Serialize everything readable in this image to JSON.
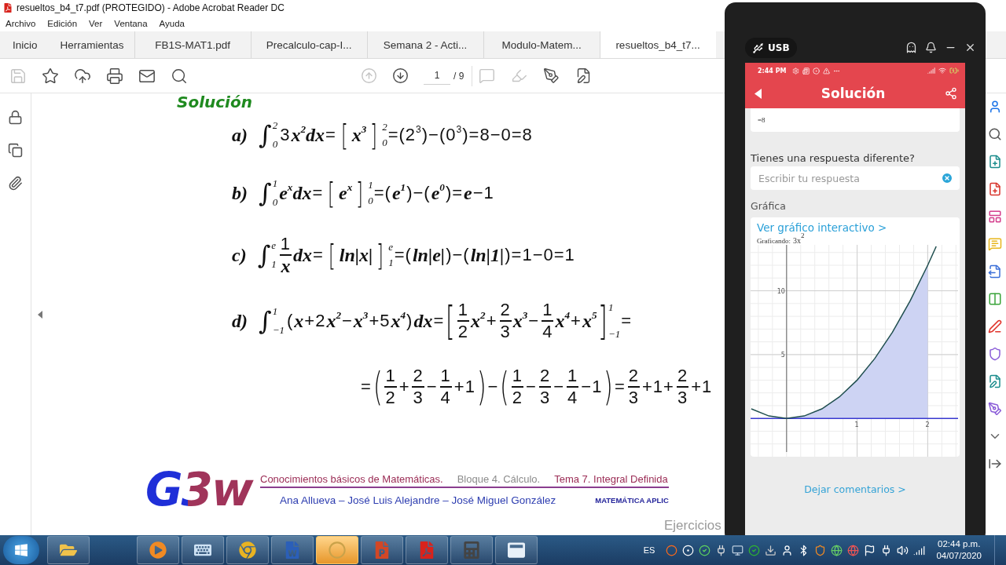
{
  "window": {
    "title": "resueltos_b4_t7.pdf (PROTEGIDO) - Adobe Acrobat Reader DC"
  },
  "menu": [
    "Archivo",
    "Edición",
    "Ver",
    "Ventana",
    "Ayuda"
  ],
  "tabs": [
    {
      "label": "Inicio",
      "kind": "nav",
      "selected": false
    },
    {
      "label": "Herramientas",
      "kind": "nav",
      "selected": false
    },
    {
      "label": "FB1S-MAT1.pdf",
      "kind": "doc",
      "selected": false
    },
    {
      "label": "Precalculo-cap-I...",
      "kind": "doc",
      "selected": false
    },
    {
      "label": "Semana 2 - Acti...",
      "kind": "doc",
      "selected": false
    },
    {
      "label": "Modulo-Matem...",
      "kind": "doc",
      "selected": false
    },
    {
      "label": "resueltos_b4_t7...",
      "kind": "doc",
      "selected": true
    }
  ],
  "toolbar": {
    "tools": [
      {
        "disabled": true
      },
      {
        "disabled": false
      },
      {
        "disabled": false
      },
      {
        "disabled": false
      },
      {
        "disabled": false
      },
      {
        "disabled": false
      }
    ],
    "nav": [
      {
        "disabled": true
      },
      {
        "disabled": false
      }
    ],
    "page_number": "1",
    "page_count": "/ 9",
    "edit_tools": [
      {
        "disabled": true
      },
      {
        "disabled": true
      },
      {
        "disabled": false
      },
      {
        "disabled": false
      }
    ]
  },
  "document": {
    "heading": "Solución",
    "equations": [
      {
        "kind": "line",
        "tokens": [
          {
            "kind": "var",
            "text": "a)"
          },
          {
            "kind": "int",
            "sign": "∫",
            "lower": "0",
            "upper": "2"
          },
          {
            "kind": "num",
            "text": "3"
          },
          {
            "kind": "var",
            "text": "x$^{2}$dx"
          },
          {
            "kind": "num",
            "text": "="
          },
          {
            "kind": "group",
            "open": "[",
            "close": "]",
            "lower": "0",
            "upper": "2",
            "body": [
              {
                "kind": "var",
                "text": "x$^{3}$"
              }
            ]
          },
          {
            "kind": "num",
            "text": "=(2$^{3}$)−(0$^{3}$)=8−0=8"
          }
        ]
      },
      {
        "kind": "line",
        "tokens": [
          {
            "kind": "var",
            "text": "b)"
          },
          {
            "kind": "int",
            "sign": "∫",
            "lower": "0",
            "upper": "1"
          },
          {
            "kind": "var",
            "text": "e$^{x}$dx"
          },
          {
            "kind": "num",
            "text": "="
          },
          {
            "kind": "group",
            "open": "[",
            "close": "]",
            "lower": "0",
            "upper": "1",
            "body": [
              {
                "kind": "var",
                "text": "e$^{x}$"
              }
            ]
          },
          {
            "kind": "num",
            "text": "=("
          },
          {
            "kind": "var",
            "text": "e$^{1}$"
          },
          {
            "kind": "num",
            "text": ")−("
          },
          {
            "kind": "var",
            "text": "e$^{0}$"
          },
          {
            "kind": "num",
            "text": ")="
          },
          {
            "kind": "var",
            "text": "e"
          },
          {
            "kind": "num",
            "text": "−1"
          }
        ]
      },
      {
        "kind": "line",
        "tokens": [
          {
            "kind": "var",
            "text": "c)"
          },
          {
            "kind": "int",
            "sign": "∫",
            "lower": "1",
            "upper": "e"
          },
          {
            "kind": "frac",
            "num": [
              {
                "kind": "num",
                "text": "1"
              }
            ],
            "den": [
              {
                "kind": "var",
                "text": "x"
              }
            ]
          },
          {
            "kind": "var",
            "text": "dx"
          },
          {
            "kind": "num",
            "text": "="
          },
          {
            "kind": "group",
            "open": "[",
            "close": "]",
            "lower": "1",
            "upper": "e",
            "body": [
              {
                "kind": "var",
                "text": "ln|x|"
              }
            ]
          },
          {
            "kind": "num",
            "text": "=("
          },
          {
            "kind": "var",
            "text": "ln|e|"
          },
          {
            "kind": "num",
            "text": ")−("
          },
          {
            "kind": "var",
            "text": "ln|1|"
          },
          {
            "kind": "num",
            "text": ")=1−0=1"
          }
        ]
      },
      {
        "kind": "line",
        "tokens": [
          {
            "kind": "var",
            "text": "d)"
          },
          {
            "kind": "int",
            "sign": "∫",
            "lower": "−1",
            "upper": "1"
          },
          {
            "kind": "num",
            "text": "("
          },
          {
            "kind": "var",
            "text": "x"
          },
          {
            "kind": "num",
            "text": "+2"
          },
          {
            "kind": "var",
            "text": "x$^{2}$"
          },
          {
            "kind": "num",
            "text": "−"
          },
          {
            "kind": "var",
            "text": "x$^{3}$"
          },
          {
            "kind": "num",
            "text": "+5"
          },
          {
            "kind": "var",
            "text": "x$^{4}$"
          },
          {
            "kind": "num",
            "text": ")"
          },
          {
            "kind": "var",
            "text": "dx"
          },
          {
            "kind": "num",
            "text": "="
          },
          {
            "kind": "group",
            "open": "[",
            "close": "]",
            "lower": "−1",
            "upper": "1",
            "body": [
              {
                "kind": "frac",
                "num": [
                  {
                    "kind": "num",
                    "text": "1"
                  }
                ],
                "den": [
                  {
                    "kind": "num",
                    "text": "2"
                  }
                ]
              },
              {
                "kind": "var",
                "text": "x$^{2}$"
              },
              {
                "kind": "num",
                "text": "+"
              },
              {
                "kind": "frac",
                "num": [
                  {
                    "kind": "num",
                    "text": "2"
                  }
                ],
                "den": [
                  {
                    "kind": "num",
                    "text": "3"
                  }
                ]
              },
              {
                "kind": "var",
                "text": "x$^{3}$"
              },
              {
                "kind": "num",
                "text": "−"
              },
              {
                "kind": "frac",
                "num": [
                  {
                    "kind": "num",
                    "text": "1"
                  }
                ],
                "den": [
                  {
                    "kind": "num",
                    "text": "4"
                  }
                ]
              },
              {
                "kind": "var",
                "text": "x$^{4}$"
              },
              {
                "kind": "num",
                "text": "+"
              },
              {
                "kind": "var",
                "text": "x$^{5}$"
              }
            ]
          },
          {
            "kind": "num",
            "text": "="
          }
        ]
      },
      {
        "kind": "continuation",
        "tokens": [
          {
            "kind": "num",
            "text": "="
          },
          {
            "kind": "group",
            "open": "(",
            "close": ")",
            "body": [
              {
                "kind": "frac",
                "num": [
                  {
                    "kind": "num",
                    "text": "1"
                  }
                ],
                "den": [
                  {
                    "kind": "num",
                    "text": "2"
                  }
                ]
              },
              {
                "kind": "num",
                "text": "+"
              },
              {
                "kind": "frac",
                "num": [
                  {
                    "kind": "num",
                    "text": "2"
                  }
                ],
                "den": [
                  {
                    "kind": "num",
                    "text": "3"
                  }
                ]
              },
              {
                "kind": "num",
                "text": "−"
              },
              {
                "kind": "frac",
                "num": [
                  {
                    "kind": "num",
                    "text": "1"
                  }
                ],
                "den": [
                  {
                    "kind": "num",
                    "text": "4"
                  }
                ]
              },
              {
                "kind": "num",
                "text": "+1"
              }
            ]
          },
          {
            "kind": "num",
            "text": "−"
          },
          {
            "kind": "group",
            "open": "(",
            "close": ")",
            "body": [
              {
                "kind": "frac",
                "num": [
                  {
                    "kind": "num",
                    "text": "1"
                  }
                ],
                "den": [
                  {
                    "kind": "num",
                    "text": "2"
                  }
                ]
              },
              {
                "kind": "num",
                "text": "−"
              },
              {
                "kind": "frac",
                "num": [
                  {
                    "kind": "num",
                    "text": "2"
                  }
                ],
                "den": [
                  {
                    "kind": "num",
                    "text": "3"
                  }
                ]
              },
              {
                "kind": "num",
                "text": "−"
              },
              {
                "kind": "frac",
                "num": [
                  {
                    "kind": "num",
                    "text": "1"
                  }
                ],
                "den": [
                  {
                    "kind": "num",
                    "text": "4"
                  }
                ]
              },
              {
                "kind": "num",
                "text": "−1"
              }
            ]
          },
          {
            "kind": "num",
            "text": "="
          },
          {
            "kind": "frac",
            "num": [
              {
                "kind": "num",
                "text": "2"
              }
            ],
            "den": [
              {
                "kind": "num",
                "text": "3"
              }
            ]
          },
          {
            "kind": "num",
            "text": "+1+"
          },
          {
            "kind": "frac",
            "num": [
              {
                "kind": "num",
                "text": "2"
              }
            ],
            "den": [
              {
                "kind": "num",
                "text": "3"
              }
            ]
          },
          {
            "kind": "num",
            "text": "+1"
          }
        ]
      }
    ],
    "footer": {
      "logo": "G3w",
      "header_parts": [
        {
          "text": "Conocimientos básicos de Matemáticas.",
          "color": "#9b2c55"
        },
        {
          "text": "Bloque 4. Cálculo.",
          "color": "#8c8c8c"
        },
        {
          "text": "Tema 7. Integral Definida",
          "color": "#9b2c55"
        }
      ],
      "authors": "Ana Allueva – José Luis Alejandre – José Miguel González",
      "series": "MATEMÁTICA APLIC",
      "section": "Ejercicios"
    }
  },
  "phone": {
    "connection": "USB",
    "status_time": "2:44 PM",
    "title": "Solución",
    "answer_preview": "=8",
    "question": "Tienes una respuesta diferente?",
    "answer_field": {
      "placeholder": "Escribir tu respuesta"
    },
    "section": "Gráfica",
    "graph_link": "Ver gráfico interactivo >",
    "graph_caption": "Graficando:",
    "chart_data": {
      "type": "line",
      "x": [
        -0.5,
        -0.25,
        0,
        0.25,
        0.5,
        0.75,
        1,
        1.25,
        1.5,
        1.75,
        2,
        2.12
      ],
      "series": [
        {
          "name": "3x$^{2}$",
          "color": "#1f4e4e",
          "values": [
            0.75,
            0.19,
            0,
            0.19,
            0.75,
            1.69,
            3,
            4.69,
            6.75,
            9.19,
            12,
            13.48
          ]
        }
      ],
      "xlim": [
        -0.51,
        2.43
      ],
      "ylim": [
        -3,
        13.6
      ],
      "xticks": [
        1,
        2
      ],
      "yticks": [
        5,
        10
      ],
      "grid": true
    },
    "feedback_link": "Dejar comentarios >"
  },
  "taskbar": {
    "apps": [
      {
        "selected": false
      },
      {
        "selected": false
      },
      {
        "selected": false
      },
      {
        "selected": false
      },
      {
        "selected": false
      },
      {
        "selected": true
      },
      {
        "selected": false
      },
      {
        "selected": false
      },
      {
        "selected": false
      },
      {
        "selected": false
      }
    ],
    "language": "ES",
    "clock_time": "02:44 p.m.",
    "clock_date": "04/07/2020"
  }
}
